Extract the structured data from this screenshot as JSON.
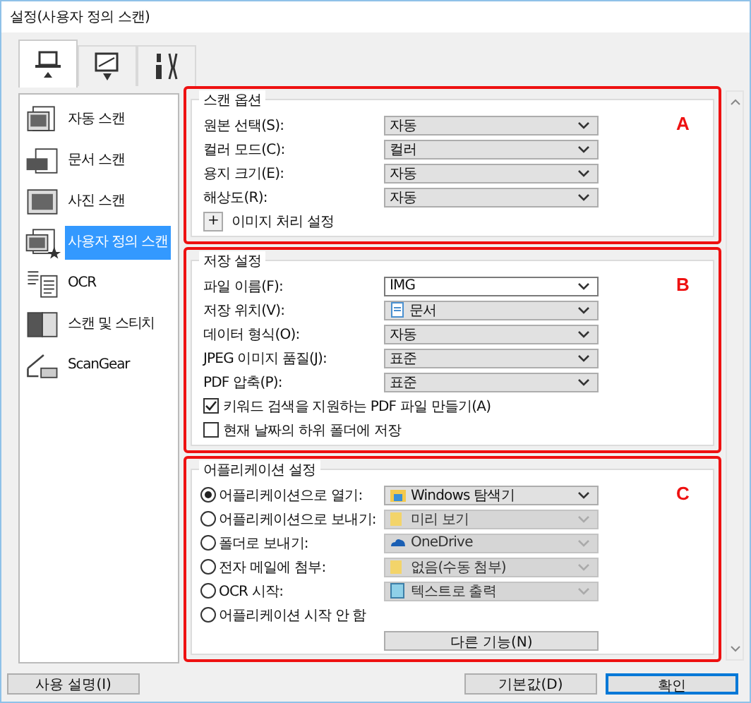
{
  "window": {
    "title": "설정(사용자 정의 스캔)"
  },
  "tabs": [
    {
      "kind": "scan",
      "selected": true
    },
    {
      "kind": "save",
      "selected": false
    },
    {
      "kind": "tools",
      "selected": false
    }
  ],
  "sidebar": {
    "items": [
      {
        "kind": "auto",
        "label": "자동 스캔",
        "selected": false
      },
      {
        "kind": "document",
        "label": "문서 스캔",
        "selected": false
      },
      {
        "kind": "photo",
        "label": "사진 스캔",
        "selected": false
      },
      {
        "kind": "custom",
        "label": "사용자 정의 스캔",
        "selected": true
      },
      {
        "kind": "ocr",
        "label": "OCR",
        "selected": false
      },
      {
        "kind": "stitch",
        "label": "스캔 및 스티치",
        "selected": false
      },
      {
        "kind": "scangear",
        "label": "ScanGear",
        "selected": false
      }
    ]
  },
  "sections": [
    {
      "title": "스캔 옵션",
      "marker": "A",
      "rows": [
        {
          "kind": "select",
          "label": "원본 선택(S):",
          "value": "자동",
          "disabled": false
        },
        {
          "kind": "select",
          "label": "컬러 모드(C):",
          "value": "컬러",
          "disabled": false
        },
        {
          "kind": "select",
          "label": "용지 크기(E):",
          "value": "자동",
          "disabled": false
        },
        {
          "kind": "select",
          "label": "해상도(R):",
          "value": "자동",
          "disabled": false
        },
        {
          "kind": "expander",
          "symbol": "+",
          "label": "이미지 처리 설정"
        }
      ]
    },
    {
      "title": "저장 설정",
      "marker": "B",
      "rows": [
        {
          "kind": "combo",
          "label": "파일 이름(F):",
          "value": "IMG"
        },
        {
          "kind": "select",
          "label": "저장 위치(V):",
          "value": "문서",
          "disabled": false
        },
        {
          "kind": "select",
          "label": "데이터 형식(O):",
          "value": "자동",
          "disabled": false
        },
        {
          "kind": "select",
          "label": "JPEG 이미지 품질(J):",
          "value": "표준",
          "disabled": false
        },
        {
          "kind": "select",
          "label": "PDF 압축(P):",
          "value": "표준",
          "disabled": false
        },
        {
          "kind": "checkbox",
          "label": "키워드 검색을 지원하는 PDF 파일 만들기(A)",
          "checked": true
        },
        {
          "kind": "checkbox",
          "label": "현재 날짜의 하위 폴더에 저장",
          "checked": false
        }
      ]
    },
    {
      "title": "어플리케이션 설정",
      "marker": "C",
      "rows": [
        {
          "kind": "radio",
          "label": "어플리케이션으로 열기:",
          "selected": true,
          "value": "Windows 탐색기",
          "disabled": false
        },
        {
          "kind": "radio",
          "label": "어플리케이션으로 보내기:",
          "selected": false,
          "value": "미리 보기",
          "disabled": true
        },
        {
          "kind": "radio",
          "label": "폴더로 보내기:",
          "selected": false,
          "value": "OneDrive",
          "disabled": true
        },
        {
          "kind": "radio",
          "label": "전자 메일에 첨부:",
          "selected": false,
          "value": "없음(수동 첨부)",
          "disabled": true
        },
        {
          "kind": "radio",
          "label": "OCR 시작:",
          "selected": false,
          "value": "텍스트로 출력",
          "disabled": true
        },
        {
          "kind": "radio",
          "label": "어플리케이션 시작 안 함",
          "selected": false
        },
        {
          "kind": "button",
          "label": "다른 기능(N)"
        }
      ]
    }
  ],
  "footer": {
    "buttons": [
      {
        "label": "사용 설명(I)",
        "kind": "left"
      },
      {
        "label": "기본값(D)",
        "kind": "right"
      },
      {
        "label": "확인",
        "kind": "default"
      }
    ]
  }
}
